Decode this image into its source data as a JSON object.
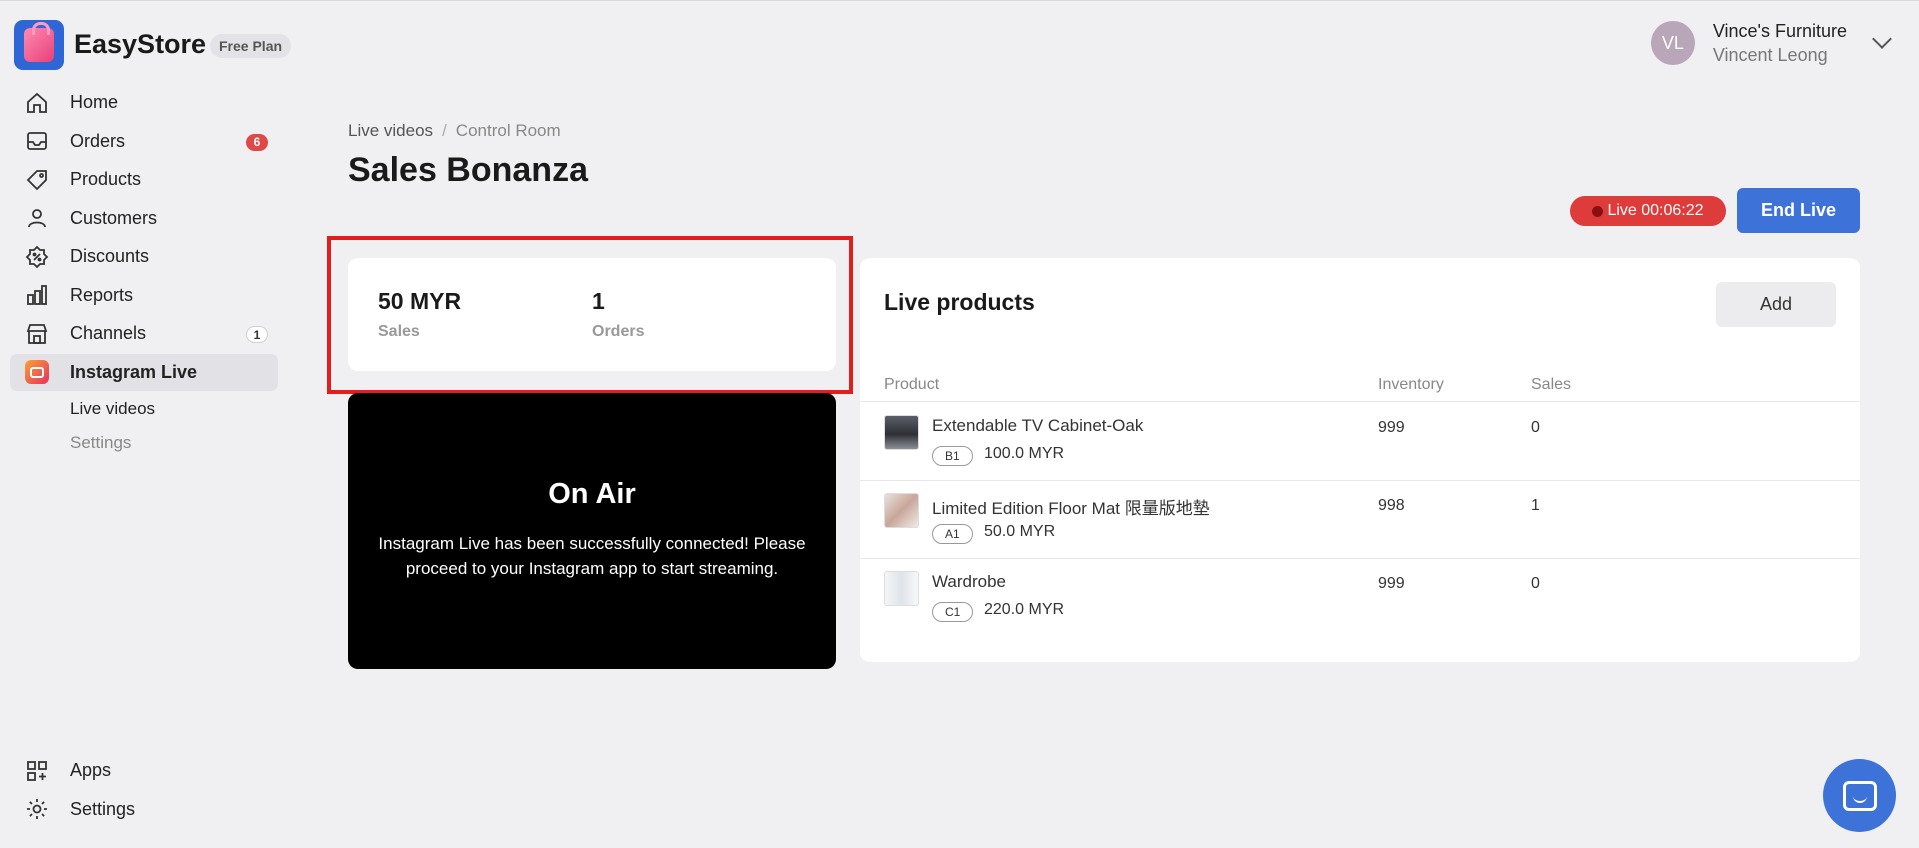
{
  "header": {
    "brand": "EasyStore",
    "plan": "Free Plan",
    "avatar_initials": "VL",
    "store_name": "Vince's Furniture",
    "user_name": "Vincent Leong"
  },
  "sidebar": {
    "items": [
      {
        "label": "Home",
        "icon": "home-icon"
      },
      {
        "label": "Orders",
        "icon": "inbox-icon",
        "badge": "6"
      },
      {
        "label": "Products",
        "icon": "tag-icon"
      },
      {
        "label": "Customers",
        "icon": "person-icon"
      },
      {
        "label": "Discounts",
        "icon": "discount-icon"
      },
      {
        "label": "Reports",
        "icon": "bar-chart-icon"
      },
      {
        "label": "Channels",
        "icon": "store-icon",
        "badge": "1"
      },
      {
        "label": "Instagram Live",
        "icon": "instagram-live-icon"
      }
    ],
    "subitems": [
      {
        "label": "Live videos"
      },
      {
        "label": "Settings"
      }
    ],
    "bottom": [
      {
        "label": "Apps",
        "icon": "apps-icon"
      },
      {
        "label": "Settings",
        "icon": "gear-icon"
      }
    ]
  },
  "breadcrumb": {
    "parent": "Live videos",
    "separator": "/",
    "current": "Control Room"
  },
  "page": {
    "title": "Sales Bonanza",
    "live_status": "Live 00:06:22",
    "end_button": "End Live"
  },
  "stats": {
    "sales_value": "50 MYR",
    "sales_label": "Sales",
    "orders_value": "1",
    "orders_label": "Orders"
  },
  "on_air": {
    "title": "On Air",
    "message": "Instagram Live has been successfully connected! Please proceed to your Instagram app to start streaming."
  },
  "live_products": {
    "title": "Live products",
    "add_button": "Add",
    "columns": [
      "Product",
      "Inventory",
      "Sales"
    ],
    "rows": [
      {
        "name": "Extendable TV Cabinet-Oak",
        "sku": "B1",
        "price": "100.0 MYR",
        "inventory": "999",
        "sales": "0"
      },
      {
        "name": "Limited Edition Floor Mat 限量版地墊",
        "sku": "A1",
        "price": "50.0 MYR",
        "inventory": "998",
        "sales": "1"
      },
      {
        "name": "Wardrobe",
        "sku": "C1",
        "price": "220.0 MYR",
        "inventory": "999",
        "sales": "0"
      }
    ]
  },
  "colors": {
    "accent": "#3d72d8",
    "live_red": "#de3b3b",
    "highlight": "#e31c1c"
  }
}
